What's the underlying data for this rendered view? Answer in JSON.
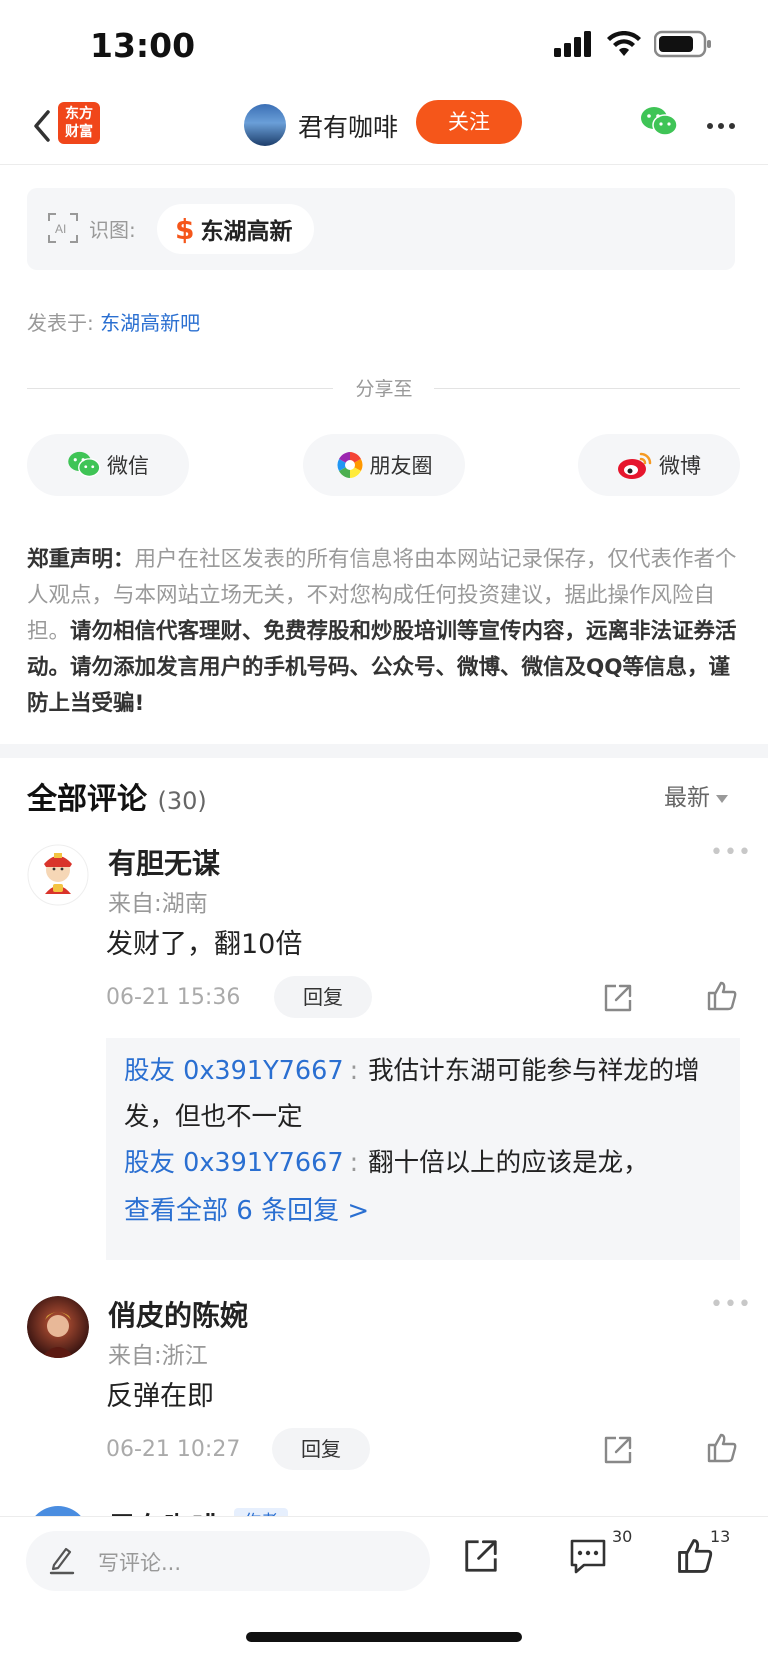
{
  "status_bar": {
    "time": "13:00"
  },
  "nav": {
    "logo_text": "东方\n财富",
    "logo_line1": "东方",
    "logo_line2": "财富",
    "author_name": "君有咖啡",
    "follow_label": "关注"
  },
  "ai_recognize": {
    "label": "识图:",
    "stock_symbol": "$",
    "stock_name": "东湖高新"
  },
  "posted_in": {
    "prefix": "发表于: ",
    "bar_name": "东湖高新吧"
  },
  "share": {
    "title": "分享至",
    "buttons": [
      {
        "label": "微信",
        "icon": "wechat-icon"
      },
      {
        "label": "朋友圈",
        "icon": "moments-icon"
      },
      {
        "label": "微博",
        "icon": "weibo-icon"
      }
    ]
  },
  "disclaimer": {
    "heading": "郑重声明：",
    "normal_text": "用户在社区发表的所有信息将由本网站记录保存，仅代表作者个人观点，与本网站立场无关，不对您构成任何投资建议，据此操作风险自担。",
    "bold_text": "请勿相信代客理财、免费荐股和炒股培训等宣传内容，远离非法证券活动。请勿添加发言用户的手机号码、公众号、微博、微信及QQ等信息，谨防上当受骗!"
  },
  "comments_header": {
    "title": "全部评论",
    "count": "(30)",
    "sort_label": "最新"
  },
  "comments": [
    {
      "name": "有胆无谋",
      "location": "来自:湖南",
      "text": "发财了，翻10倍",
      "time": "06-21 15:36",
      "reply_label": "回复",
      "replies": [
        {
          "user": "股友 0x391Y7667",
          "text": "我估计东湖可能参与祥龙的增发，但也不一定"
        },
        {
          "user": "股友 0x391Y7667",
          "text": "翻十倍以上的应该是龙，"
        }
      ],
      "view_all": "查看全部 6 条回复 >"
    },
    {
      "name": "俏皮的陈婉",
      "location": "来自:浙江",
      "text": "反弹在即",
      "time": "06-21 10:27",
      "reply_label": "回复"
    },
    {
      "name": "君有咖啡",
      "badge": "作者"
    }
  ],
  "bottom_bar": {
    "input_placeholder": "写评论...",
    "comment_count": "30",
    "like_count": "13"
  },
  "colors": {
    "accent_orange": "#f5561a",
    "link_blue": "#2a6fd1",
    "logo_red": "#f0461a"
  }
}
